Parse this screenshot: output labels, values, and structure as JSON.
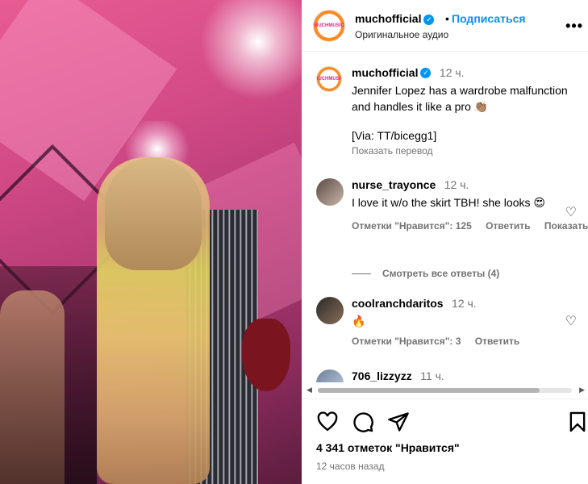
{
  "post": {
    "account": "muchofficial",
    "avatar_text": "MUCHMUSIC",
    "follow_label": "Подписаться",
    "audio_label": "Оригинальное аудио",
    "caption_time": "12 ч.",
    "caption_text": "Jennifer Lopez has a wardrobe malfunction and handles it like a pro 👏🏽",
    "caption_via": "[Via: TT/bicegg1]",
    "translate_label": "Показать перевод"
  },
  "comments": [
    {
      "user": "nurse_trayonce",
      "time": "12 ч.",
      "text": "I love it w/o the skirt TBH! she looks 😍",
      "likes_label": "Отметки \"Нравится\": 125",
      "reply_label": "Ответить",
      "extra_label": "Показать"
    },
    {
      "user": "coolranchdaritos",
      "time": "12 ч.",
      "text": "🔥",
      "likes_label": "Отметки \"Нравится\": 3",
      "reply_label": "Ответить"
    },
    {
      "user": "706_lizzyzz",
      "time": "11 ч."
    }
  ],
  "view_replies_label": "Смотреть все ответы (4)",
  "footer": {
    "likes_count": "4 341 отметок \"Нравится\"",
    "posted_time": "12 часов назад"
  },
  "icons": {
    "like": "heart-icon",
    "comment": "comment-icon",
    "share": "share-icon",
    "save": "bookmark-icon",
    "more": "more-icon"
  },
  "colors": {
    "link_blue": "#0095f6",
    "muted_text": "#737373"
  }
}
